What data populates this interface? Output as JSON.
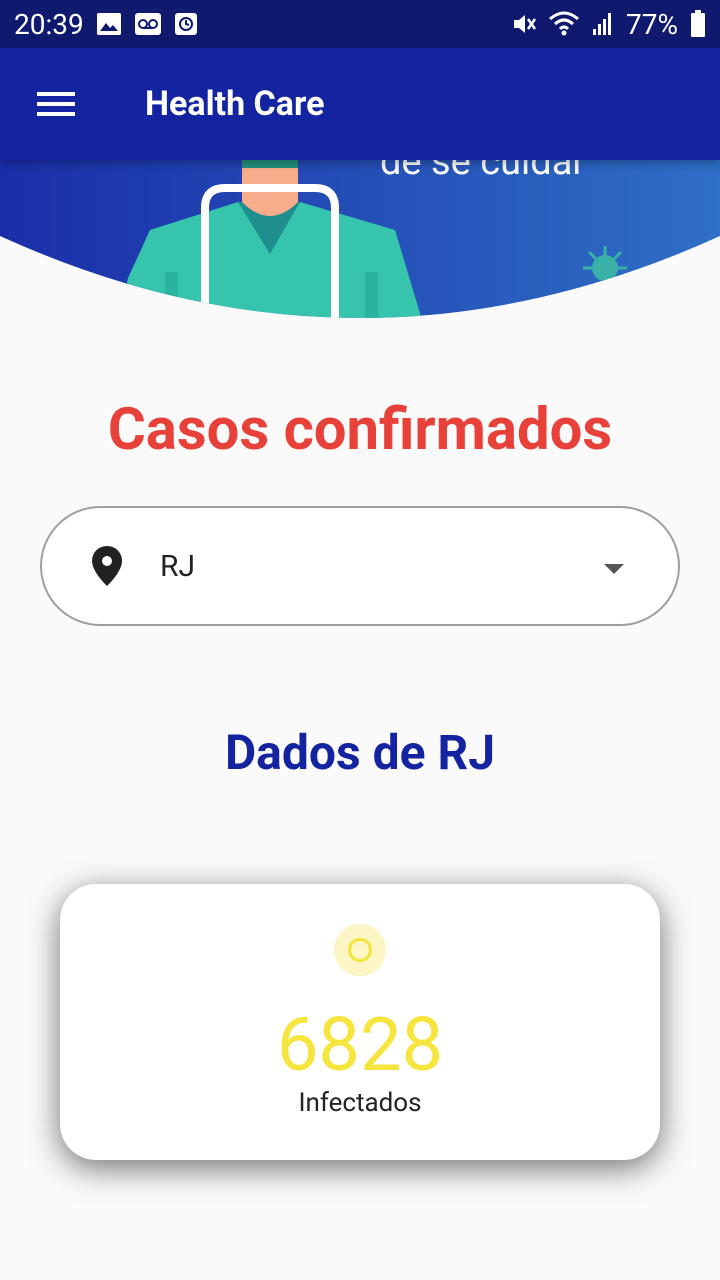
{
  "status_bar": {
    "time": "20:39",
    "battery": "77%"
  },
  "app_bar": {
    "title": "Health Care"
  },
  "hero": {
    "text": "de se cuidar"
  },
  "page": {
    "title": "Casos confirmados",
    "subtitle": "Dados de RJ"
  },
  "location_select": {
    "value": "RJ"
  },
  "stat_card": {
    "value": "6828",
    "label": "Infectados"
  },
  "colors": {
    "status_bar": "#0f1a6e",
    "app_bar": "#1424a0",
    "title": "#e8413a",
    "subtitle": "#1424a0",
    "stat_value": "#f6e53f"
  },
  "icons": [
    "menu-icon",
    "location-pin-icon",
    "dropdown-caret-icon",
    "status-circle-icon"
  ]
}
